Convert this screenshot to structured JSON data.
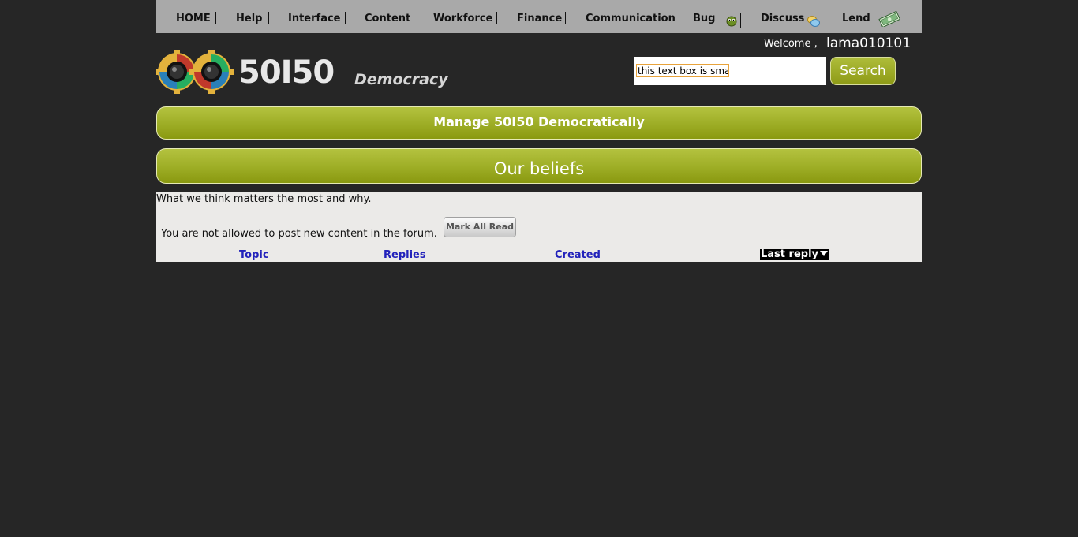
{
  "nav": {
    "items": [
      {
        "label": "HOME"
      },
      {
        "label": "Help"
      },
      {
        "label": "Interface"
      },
      {
        "label": "Content"
      },
      {
        "label": "Workforce"
      },
      {
        "label": "Finance"
      },
      {
        "label": "Communication"
      },
      {
        "label": "Bug",
        "icon": "bug-icon"
      },
      {
        "label": "Discuss",
        "icon": "discuss-icon"
      },
      {
        "label": "Lend",
        "icon": "money-icon"
      }
    ]
  },
  "header": {
    "welcome_label": "Welcome ,",
    "username": "lama010101",
    "logo": {
      "numbers": "50I50",
      "word": "Democracy"
    }
  },
  "search": {
    "value": "this text box is smal",
    "button_label": "Search"
  },
  "banners": {
    "manage": "Manage 50I50 Democratically",
    "section": "Our beliefs"
  },
  "forum": {
    "description": "What we think matters the most and why.",
    "notice": "You are not allowed to post new content in the forum.",
    "mark_all_read": "Mark All Read",
    "columns": [
      "Topic",
      "Replies",
      "Created",
      "Last reply"
    ]
  },
  "colors": {
    "background": "#262626",
    "nav_bg": "#a9a9a9",
    "accent": "#a1b12a",
    "content_bg": "#ebeae8",
    "link": "#2222bb"
  }
}
